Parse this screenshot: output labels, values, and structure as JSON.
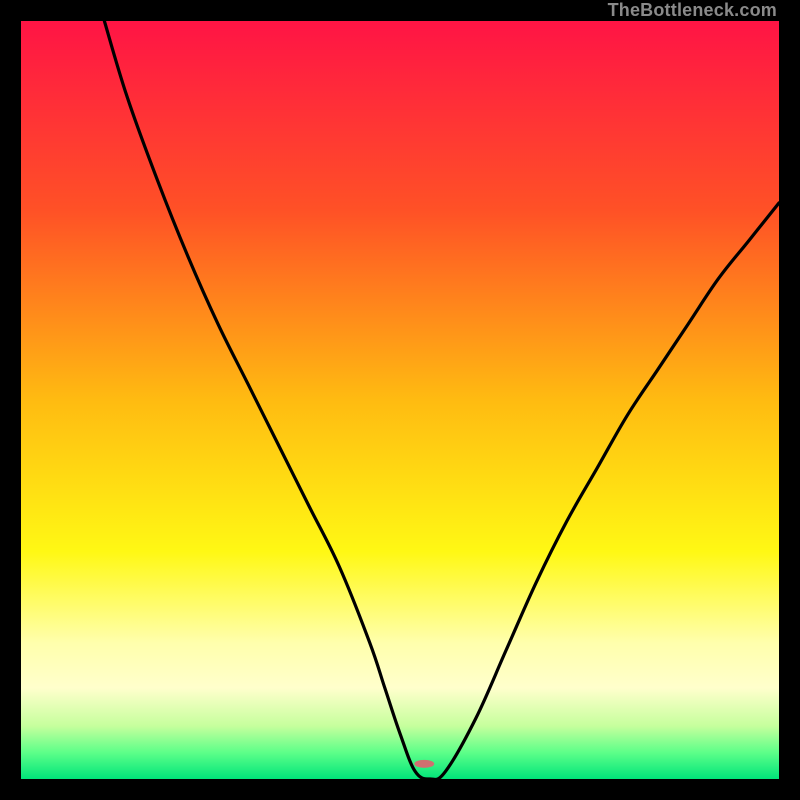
{
  "watermark": "TheBottleneck.com",
  "chart_data": {
    "type": "line",
    "title": "",
    "xlabel": "",
    "ylabel": "",
    "xlim": [
      0,
      100
    ],
    "ylim": [
      0,
      100
    ],
    "gradient_stops": [
      {
        "offset": 0.0,
        "color": "#ff1445"
      },
      {
        "offset": 0.25,
        "color": "#ff5126"
      },
      {
        "offset": 0.5,
        "color": "#ffbb11"
      },
      {
        "offset": 0.7,
        "color": "#fff814"
      },
      {
        "offset": 0.82,
        "color": "#ffffac"
      },
      {
        "offset": 0.88,
        "color": "#ffffcc"
      },
      {
        "offset": 0.93,
        "color": "#c6ff9d"
      },
      {
        "offset": 0.965,
        "color": "#5dff89"
      },
      {
        "offset": 1.0,
        "color": "#00e57a"
      }
    ],
    "series": [
      {
        "name": "bottleneck-curve",
        "x": [
          11,
          14,
          18,
          22,
          26,
          30,
          34,
          38,
          42,
          46,
          48,
          50,
          52,
          54,
          56,
          60,
          64,
          68,
          72,
          76,
          80,
          84,
          88,
          92,
          96,
          100
        ],
        "y": [
          100,
          90,
          79,
          69,
          60,
          52,
          44,
          36,
          28,
          18,
          12,
          6,
          1,
          0,
          1,
          8,
          17,
          26,
          34,
          41,
          48,
          54,
          60,
          66,
          71,
          76
        ]
      }
    ],
    "marker": {
      "x": 53.2,
      "y": 2.0,
      "color": "#d07070",
      "rx": 10,
      "ry": 4
    }
  }
}
